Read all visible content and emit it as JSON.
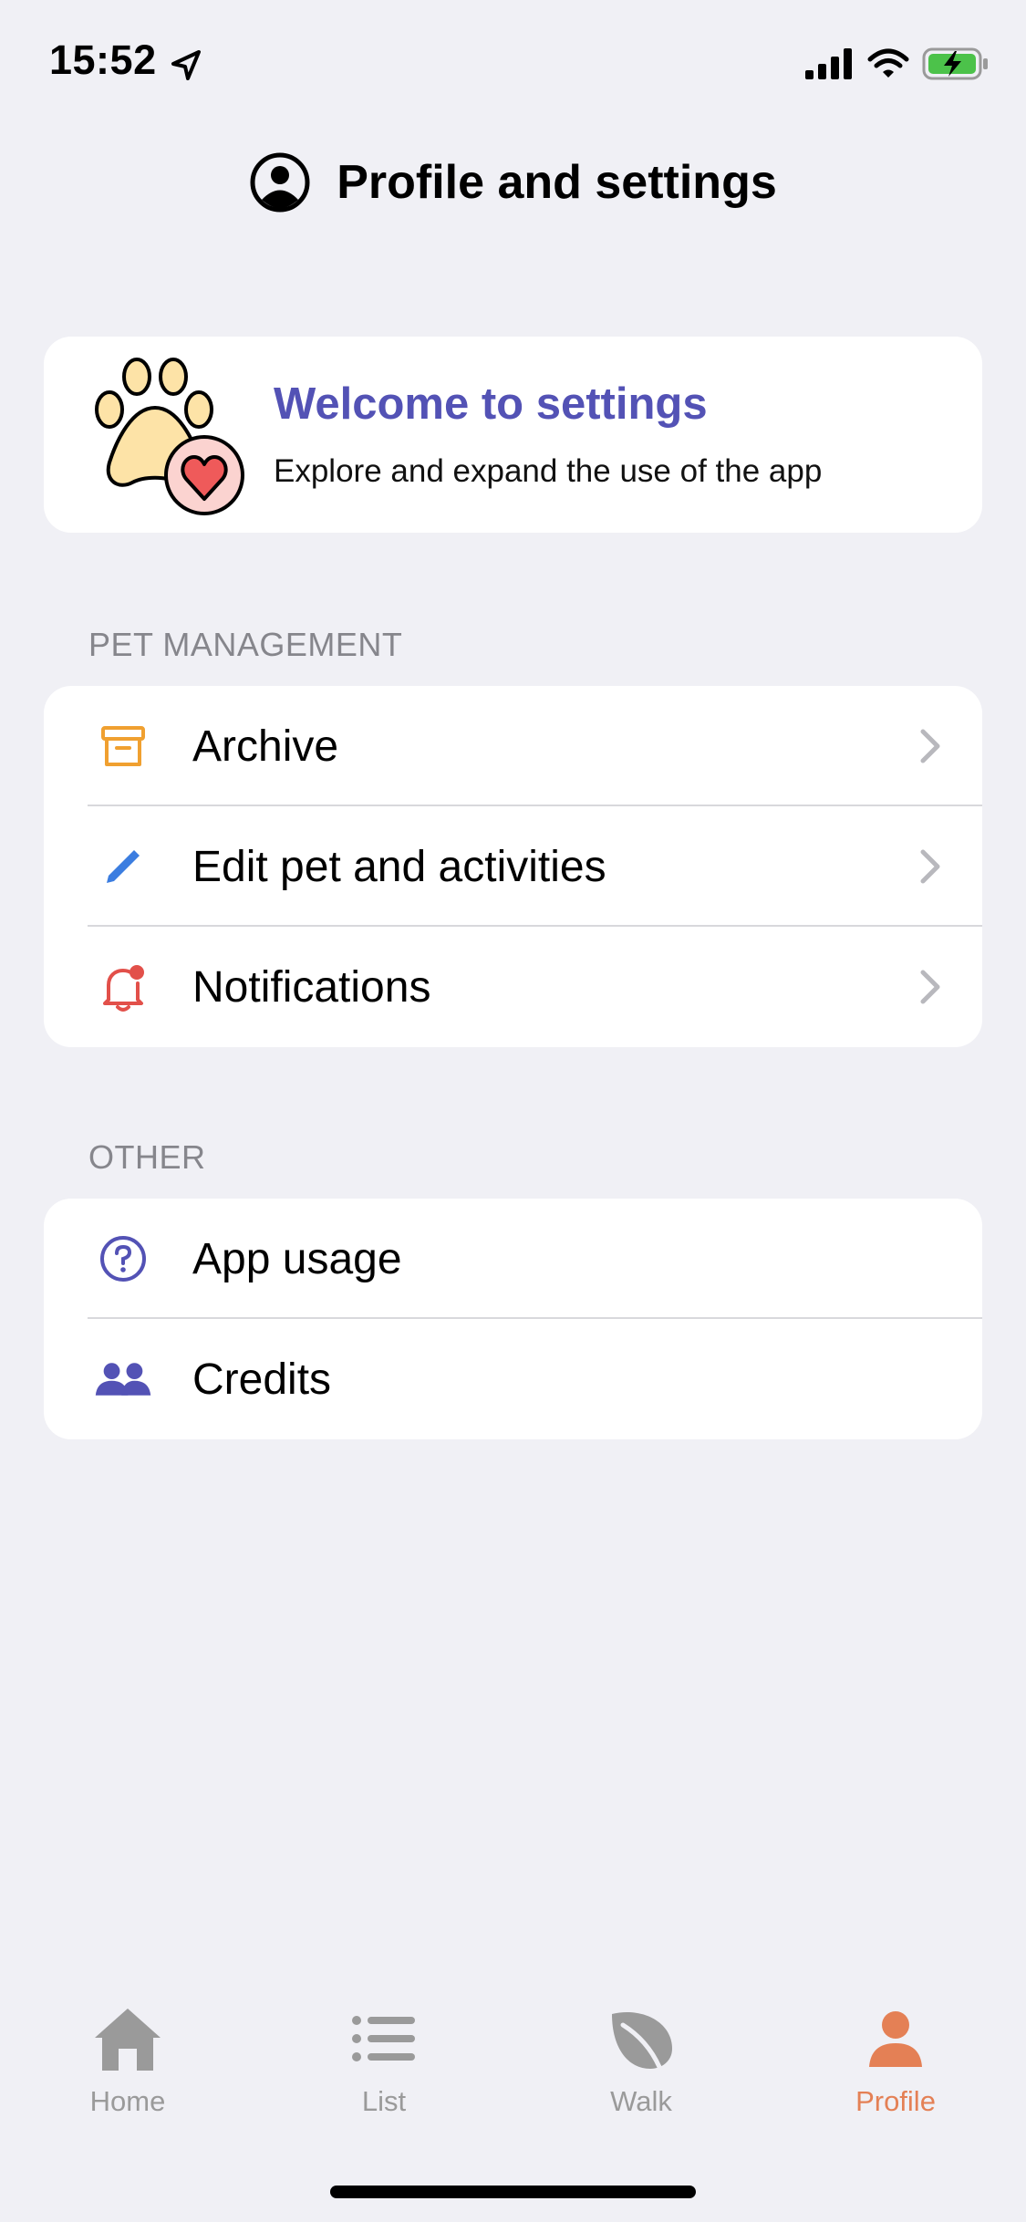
{
  "status": {
    "time": "15:52"
  },
  "header": {
    "title": "Profile and settings",
    "icon": "person-circle-icon"
  },
  "welcome": {
    "title": "Welcome to settings",
    "subtitle": "Explore and expand the use of the app",
    "illustration": "paw-heart-illustration",
    "title_color": "#5352b5"
  },
  "sections": {
    "pet_management": {
      "label": "PET MANAGEMENT",
      "items": [
        {
          "label": "Archive",
          "icon": "archive-box-icon",
          "icon_color": "#f0a030"
        },
        {
          "label": "Edit pet and activities",
          "icon": "pencil-icon",
          "icon_color": "#3b7de0"
        },
        {
          "label": "Notifications",
          "icon": "bell-badge-icon",
          "icon_color": "#e2504a"
        }
      ]
    },
    "other": {
      "label": "OTHER",
      "items": [
        {
          "label": "App usage",
          "icon": "question-circle-icon",
          "icon_color": "#5352b5"
        },
        {
          "label": "Credits",
          "icon": "people-icon",
          "icon_color": "#5352b5"
        }
      ]
    }
  },
  "tabs": [
    {
      "label": "Home",
      "icon": "house-icon",
      "active": false
    },
    {
      "label": "List",
      "icon": "list-icon",
      "active": false
    },
    {
      "label": "Walk",
      "icon": "leaf-icon",
      "active": false
    },
    {
      "label": "Profile",
      "icon": "person-icon",
      "active": true
    }
  ],
  "colors": {
    "background": "#f0f0f5",
    "accent": "#e48055",
    "tab_inactive": "#9a9a9a",
    "section_label": "#86868c"
  }
}
